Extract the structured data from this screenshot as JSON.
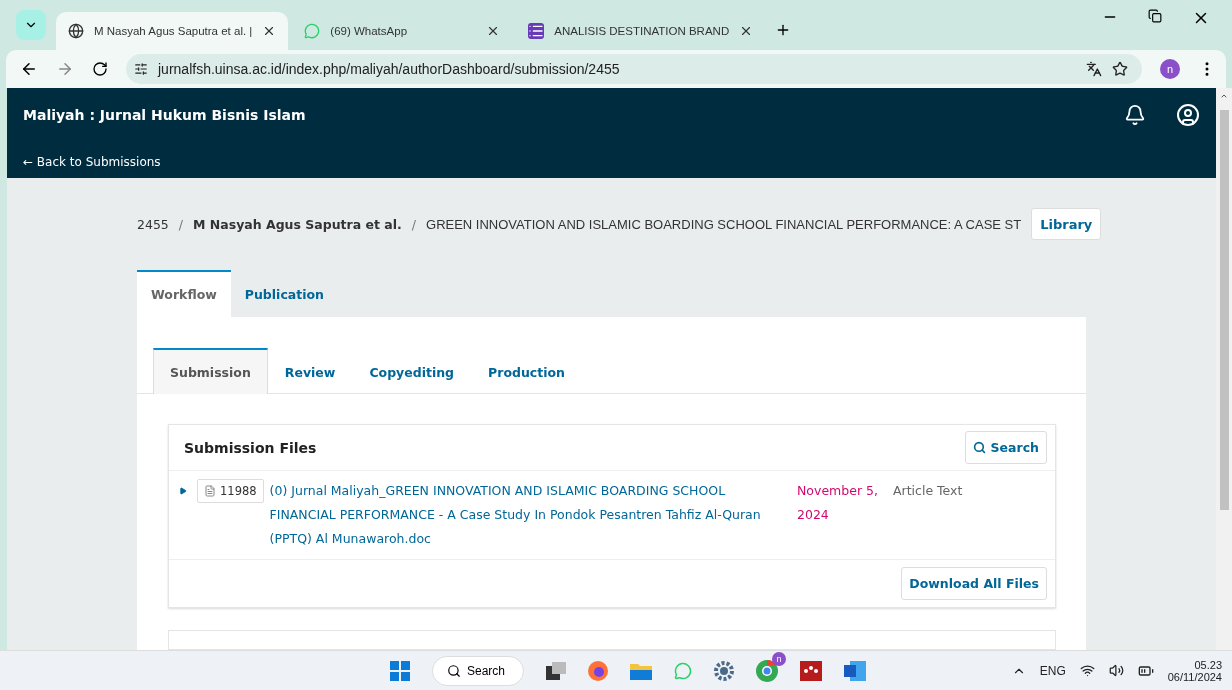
{
  "browser": {
    "tabs": [
      {
        "title": "M Nasyah Agus Saputra et al. | ",
        "kind": "globe",
        "selected": true
      },
      {
        "title": "(69) WhatsApp",
        "kind": "chat",
        "selected": false
      },
      {
        "title": "ANALISIS DESTINATION BRAND",
        "kind": "form",
        "selected": false
      }
    ],
    "url": "jurnalfsh.uinsa.ac.id/index.php/maliyah/authorDashboard/submission/2455",
    "profile_initial": "n"
  },
  "header": {
    "journal_title": "Maliyah : Jurnal Hukum Bisnis Islam",
    "back_link": "← Back to Submissions"
  },
  "breadcrumb": {
    "id": "2455",
    "separators": [
      "/",
      "/"
    ],
    "authors": "M Nasyah Agus Saputra et al.",
    "title": "GREEN INNOVATION AND ISLAMIC BOARDING SCHOOL FINANCIAL PERFORMANCE: A CASE ST",
    "library_button": "Library"
  },
  "main_tabs": [
    {
      "label": "Workflow",
      "selected": true
    },
    {
      "label": "Publication",
      "selected": false
    }
  ],
  "stage_tabs": [
    {
      "label": "Submission",
      "selected": true
    },
    {
      "label": "Review",
      "selected": false
    },
    {
      "label": "Copyediting",
      "selected": false
    },
    {
      "label": "Production",
      "selected": false
    }
  ],
  "submission_files": {
    "title": "Submission Files",
    "search_button": "Search",
    "files": [
      {
        "id": "11988",
        "name": "(0) Jurnal Maliyah_GREEN INNOVATION AND ISLAMIC BOARDING SCHOOL FINANCIAL PERFORMANCE - A Case Study In Pondok Pesantren Tahfiz Al-Quran (PPTQ) Al Munawaroh.doc",
        "date": "November 5, 2024",
        "type": "Article Text"
      }
    ],
    "download_button": "Download All Files"
  },
  "taskbar": {
    "search": "Search",
    "chrome_badge": "n",
    "language": "ENG",
    "time": "05.23",
    "date": "06/11/2024"
  }
}
